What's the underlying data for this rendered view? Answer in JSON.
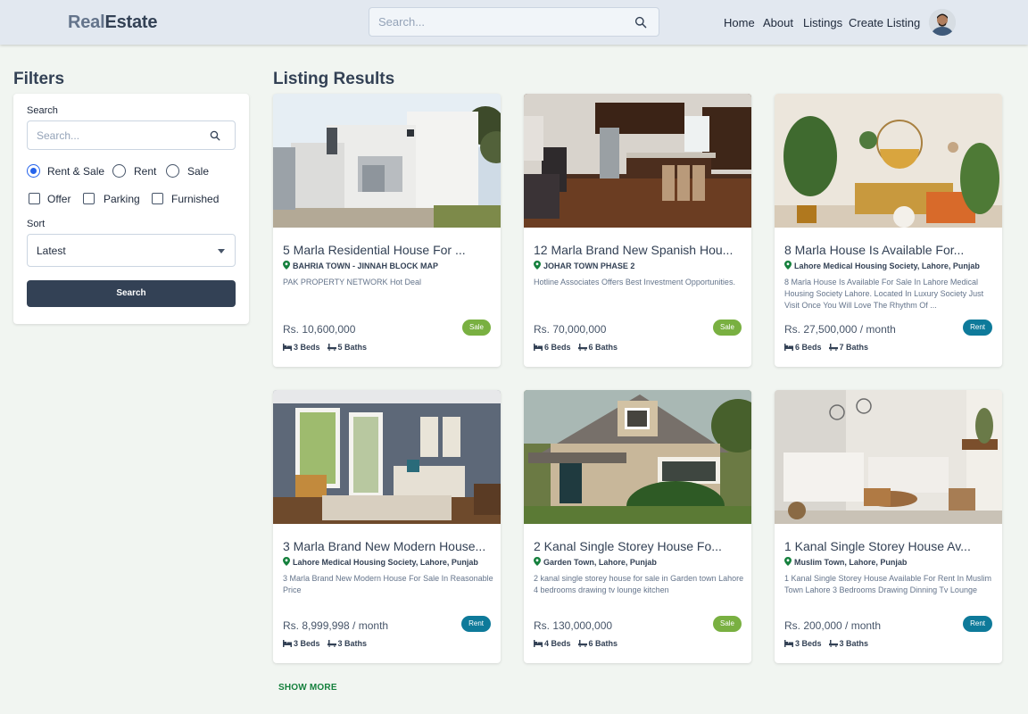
{
  "header": {
    "logo_part1": "Real",
    "logo_part2": "Estate",
    "search_placeholder": "Search...",
    "nav": [
      "Home",
      "About",
      "Listings",
      "Create Listing"
    ]
  },
  "filters": {
    "title": "Filters",
    "search_label": "Search",
    "search_placeholder": "Search...",
    "type_options": [
      {
        "label": "Rent & Sale",
        "checked": true
      },
      {
        "label": "Rent",
        "checked": false
      },
      {
        "label": "Sale",
        "checked": false
      }
    ],
    "amenities": [
      "Offer",
      "Parking",
      "Furnished"
    ],
    "sort_label": "Sort",
    "sort_value": "Latest",
    "search_button": "Search"
  },
  "results": {
    "title": "Listing Results",
    "show_more": "SHOW MORE",
    "listings": [
      {
        "title": "5 Marla Residential House For ...",
        "location": "BAHRIA TOWN - JINNAH BLOCK MAP",
        "description": "PAK PROPERTY NETWORK Hot Deal",
        "price": "Rs. 10,600,000",
        "badge": "Sale",
        "beds": "3 Beds",
        "baths": "5 Baths"
      },
      {
        "title": "12 Marla Brand New Spanish Hou...",
        "location": "JOHAR TOWN PHASE 2",
        "description": "Hotline Associates Offers Best Investment Opportunities.",
        "price": "Rs. 70,000,000",
        "badge": "Sale",
        "beds": "6 Beds",
        "baths": "6 Baths"
      },
      {
        "title": "8 Marla House Is Available For...",
        "location": "Lahore Medical Housing Society, Lahore, Punjab",
        "description": "8 Marla House Is Available For Sale In Lahore Medical Housing Society Lahore. Located In Luxury Society Just Visit Once You Will Love The Rhythm Of ...",
        "price": "Rs. 27,500,000 / month",
        "badge": "Rent",
        "beds": "6 Beds",
        "baths": "7 Baths"
      },
      {
        "title": "3 Marla Brand New Modern House...",
        "location": "Lahore Medical Housing Society, Lahore, Punjab",
        "description": "3 Marla Brand New Modern House For Sale In Reasonable Price",
        "price": "Rs. 8,999,998 / month",
        "badge": "Rent",
        "beds": "3 Beds",
        "baths": "3 Baths"
      },
      {
        "title": "2 Kanal Single Storey House Fo...",
        "location": "Garden Town, Lahore, Punjab",
        "description": "2 kanal single storey house for sale in Garden town Lahore 4 bedrooms drawing tv lounge kitchen",
        "price": "Rs. 130,000,000",
        "badge": "Sale",
        "beds": "4 Beds",
        "baths": "6 Baths"
      },
      {
        "title": "1 Kanal Single Storey House Av...",
        "location": "Muslim Town, Lahore, Punjab",
        "description": "1 Kanal Single Storey House Available For Rent In Muslim Town Lahore 3 Bedrooms Drawing Dinning Tv Lounge",
        "price": "Rs. 200,000 / month",
        "badge": "Rent",
        "beds": "3 Beds",
        "baths": "3 Baths"
      }
    ]
  },
  "colors": {
    "sale_badge": "#79b041",
    "rent_badge": "#0e7a9a",
    "primary_button": "#334155",
    "show_more": "#15803d",
    "pin": "#15803d"
  }
}
